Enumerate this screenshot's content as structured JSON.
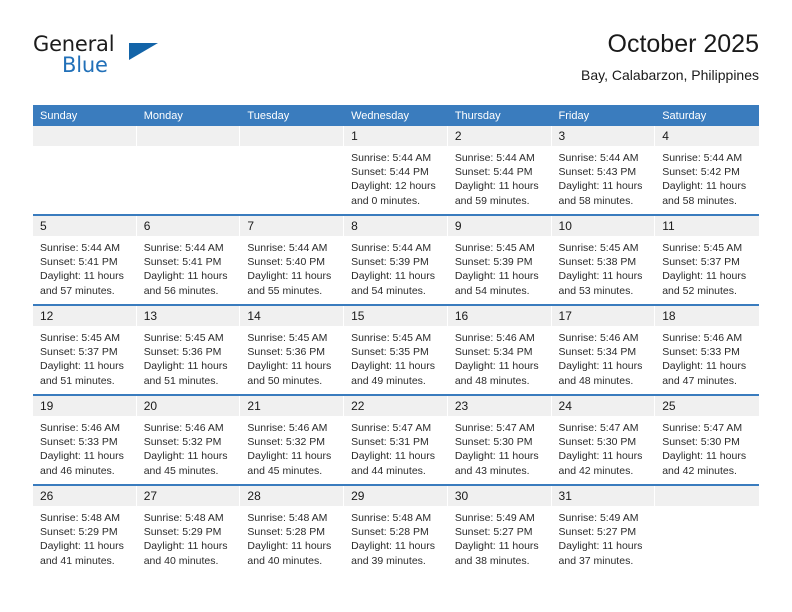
{
  "brand": {
    "name_part1": "General",
    "name_part2": "Blue",
    "triangle_color": "#1364a8",
    "blue_color": "#2170b8"
  },
  "header": {
    "title": "October 2025",
    "subtitle": "Bay, Calabarzon, Philippines"
  },
  "theme": {
    "header_blue": "#3a7cbe",
    "daynum_bg": "#f0f0f0",
    "text": "#1a1a1a"
  },
  "weekday_headers": [
    "Sunday",
    "Monday",
    "Tuesday",
    "Wednesday",
    "Thursday",
    "Friday",
    "Saturday"
  ],
  "weeks": [
    [
      {
        "day": "",
        "sunrise": "",
        "sunset": "",
        "daylight": ""
      },
      {
        "day": "",
        "sunrise": "",
        "sunset": "",
        "daylight": ""
      },
      {
        "day": "",
        "sunrise": "",
        "sunset": "",
        "daylight": ""
      },
      {
        "day": "1",
        "sunrise": "Sunrise: 5:44 AM",
        "sunset": "Sunset: 5:44 PM",
        "daylight": "Daylight: 12 hours and 0 minutes."
      },
      {
        "day": "2",
        "sunrise": "Sunrise: 5:44 AM",
        "sunset": "Sunset: 5:44 PM",
        "daylight": "Daylight: 11 hours and 59 minutes."
      },
      {
        "day": "3",
        "sunrise": "Sunrise: 5:44 AM",
        "sunset": "Sunset: 5:43 PM",
        "daylight": "Daylight: 11 hours and 58 minutes."
      },
      {
        "day": "4",
        "sunrise": "Sunrise: 5:44 AM",
        "sunset": "Sunset: 5:42 PM",
        "daylight": "Daylight: 11 hours and 58 minutes."
      }
    ],
    [
      {
        "day": "5",
        "sunrise": "Sunrise: 5:44 AM",
        "sunset": "Sunset: 5:41 PM",
        "daylight": "Daylight: 11 hours and 57 minutes."
      },
      {
        "day": "6",
        "sunrise": "Sunrise: 5:44 AM",
        "sunset": "Sunset: 5:41 PM",
        "daylight": "Daylight: 11 hours and 56 minutes."
      },
      {
        "day": "7",
        "sunrise": "Sunrise: 5:44 AM",
        "sunset": "Sunset: 5:40 PM",
        "daylight": "Daylight: 11 hours and 55 minutes."
      },
      {
        "day": "8",
        "sunrise": "Sunrise: 5:44 AM",
        "sunset": "Sunset: 5:39 PM",
        "daylight": "Daylight: 11 hours and 54 minutes."
      },
      {
        "day": "9",
        "sunrise": "Sunrise: 5:45 AM",
        "sunset": "Sunset: 5:39 PM",
        "daylight": "Daylight: 11 hours and 54 minutes."
      },
      {
        "day": "10",
        "sunrise": "Sunrise: 5:45 AM",
        "sunset": "Sunset: 5:38 PM",
        "daylight": "Daylight: 11 hours and 53 minutes."
      },
      {
        "day": "11",
        "sunrise": "Sunrise: 5:45 AM",
        "sunset": "Sunset: 5:37 PM",
        "daylight": "Daylight: 11 hours and 52 minutes."
      }
    ],
    [
      {
        "day": "12",
        "sunrise": "Sunrise: 5:45 AM",
        "sunset": "Sunset: 5:37 PM",
        "daylight": "Daylight: 11 hours and 51 minutes."
      },
      {
        "day": "13",
        "sunrise": "Sunrise: 5:45 AM",
        "sunset": "Sunset: 5:36 PM",
        "daylight": "Daylight: 11 hours and 51 minutes."
      },
      {
        "day": "14",
        "sunrise": "Sunrise: 5:45 AM",
        "sunset": "Sunset: 5:36 PM",
        "daylight": "Daylight: 11 hours and 50 minutes."
      },
      {
        "day": "15",
        "sunrise": "Sunrise: 5:45 AM",
        "sunset": "Sunset: 5:35 PM",
        "daylight": "Daylight: 11 hours and 49 minutes."
      },
      {
        "day": "16",
        "sunrise": "Sunrise: 5:46 AM",
        "sunset": "Sunset: 5:34 PM",
        "daylight": "Daylight: 11 hours and 48 minutes."
      },
      {
        "day": "17",
        "sunrise": "Sunrise: 5:46 AM",
        "sunset": "Sunset: 5:34 PM",
        "daylight": "Daylight: 11 hours and 48 minutes."
      },
      {
        "day": "18",
        "sunrise": "Sunrise: 5:46 AM",
        "sunset": "Sunset: 5:33 PM",
        "daylight": "Daylight: 11 hours and 47 minutes."
      }
    ],
    [
      {
        "day": "19",
        "sunrise": "Sunrise: 5:46 AM",
        "sunset": "Sunset: 5:33 PM",
        "daylight": "Daylight: 11 hours and 46 minutes."
      },
      {
        "day": "20",
        "sunrise": "Sunrise: 5:46 AM",
        "sunset": "Sunset: 5:32 PM",
        "daylight": "Daylight: 11 hours and 45 minutes."
      },
      {
        "day": "21",
        "sunrise": "Sunrise: 5:46 AM",
        "sunset": "Sunset: 5:32 PM",
        "daylight": "Daylight: 11 hours and 45 minutes."
      },
      {
        "day": "22",
        "sunrise": "Sunrise: 5:47 AM",
        "sunset": "Sunset: 5:31 PM",
        "daylight": "Daylight: 11 hours and 44 minutes."
      },
      {
        "day": "23",
        "sunrise": "Sunrise: 5:47 AM",
        "sunset": "Sunset: 5:30 PM",
        "daylight": "Daylight: 11 hours and 43 minutes."
      },
      {
        "day": "24",
        "sunrise": "Sunrise: 5:47 AM",
        "sunset": "Sunset: 5:30 PM",
        "daylight": "Daylight: 11 hours and 42 minutes."
      },
      {
        "day": "25",
        "sunrise": "Sunrise: 5:47 AM",
        "sunset": "Sunset: 5:30 PM",
        "daylight": "Daylight: 11 hours and 42 minutes."
      }
    ],
    [
      {
        "day": "26",
        "sunrise": "Sunrise: 5:48 AM",
        "sunset": "Sunset: 5:29 PM",
        "daylight": "Daylight: 11 hours and 41 minutes."
      },
      {
        "day": "27",
        "sunrise": "Sunrise: 5:48 AM",
        "sunset": "Sunset: 5:29 PM",
        "daylight": "Daylight: 11 hours and 40 minutes."
      },
      {
        "day": "28",
        "sunrise": "Sunrise: 5:48 AM",
        "sunset": "Sunset: 5:28 PM",
        "daylight": "Daylight: 11 hours and 40 minutes."
      },
      {
        "day": "29",
        "sunrise": "Sunrise: 5:48 AM",
        "sunset": "Sunset: 5:28 PM",
        "daylight": "Daylight: 11 hours and 39 minutes."
      },
      {
        "day": "30",
        "sunrise": "Sunrise: 5:49 AM",
        "sunset": "Sunset: 5:27 PM",
        "daylight": "Daylight: 11 hours and 38 minutes."
      },
      {
        "day": "31",
        "sunrise": "Sunrise: 5:49 AM",
        "sunset": "Sunset: 5:27 PM",
        "daylight": "Daylight: 11 hours and 37 minutes."
      },
      {
        "day": "",
        "sunrise": "",
        "sunset": "",
        "daylight": ""
      }
    ]
  ]
}
